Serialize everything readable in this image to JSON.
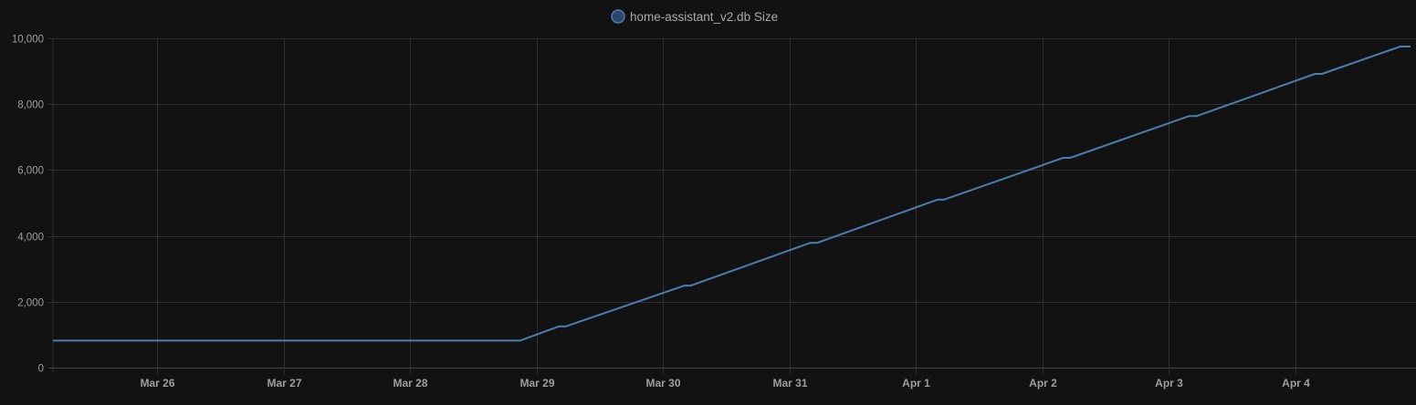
{
  "chart_data": {
    "type": "line",
    "title": "",
    "xlabel": "",
    "ylabel": "",
    "legend": {
      "position": "top-center",
      "entries": [
        "home-assistant_v2.db Size"
      ]
    },
    "grid": true,
    "colors": {
      "background": "#121212",
      "grid": "#2f2f2f",
      "text": "#9e9e9e",
      "series": "#4a7db0",
      "legend_fill": "#2c4866"
    },
    "x_unit": "days since Mar 25 00:00",
    "xlim": [
      0.177,
      10.91
    ],
    "ylim": [
      0,
      10000
    ],
    "x_ticks": [
      {
        "value": 1,
        "label": "Mar 26"
      },
      {
        "value": 2,
        "label": "Mar 27"
      },
      {
        "value": 3,
        "label": "Mar 28"
      },
      {
        "value": 4,
        "label": "Mar 29"
      },
      {
        "value": 5,
        "label": "Mar 30"
      },
      {
        "value": 6,
        "label": "Mar 31"
      },
      {
        "value": 7,
        "label": "Apr 1"
      },
      {
        "value": 8,
        "label": "Apr 2"
      },
      {
        "value": 9,
        "label": "Apr 3"
      },
      {
        "value": 10,
        "label": "Apr 4"
      }
    ],
    "y_ticks": [
      {
        "value": 0,
        "label": "0"
      },
      {
        "value": 2000,
        "label": "2,000"
      },
      {
        "value": 4000,
        "label": "4,000"
      },
      {
        "value": 6000,
        "label": "6,000"
      },
      {
        "value": 8000,
        "label": "8,000"
      },
      {
        "value": 10000,
        "label": "10,000"
      }
    ],
    "series": [
      {
        "name": "home-assistant_v2.db Size",
        "x": [
          0.177,
          3.87,
          4.175,
          4.23,
          5.17,
          5.22,
          6.165,
          6.22,
          7.17,
          7.22,
          8.165,
          8.22,
          9.16,
          9.22,
          10.155,
          10.21,
          10.83,
          10.91
        ],
        "y": [
          820,
          820,
          1250,
          1250,
          2490,
          2490,
          3790,
          3790,
          5100,
          5100,
          6370,
          6370,
          7640,
          7640,
          8920,
          8920,
          9750,
          9750
        ]
      }
    ]
  }
}
